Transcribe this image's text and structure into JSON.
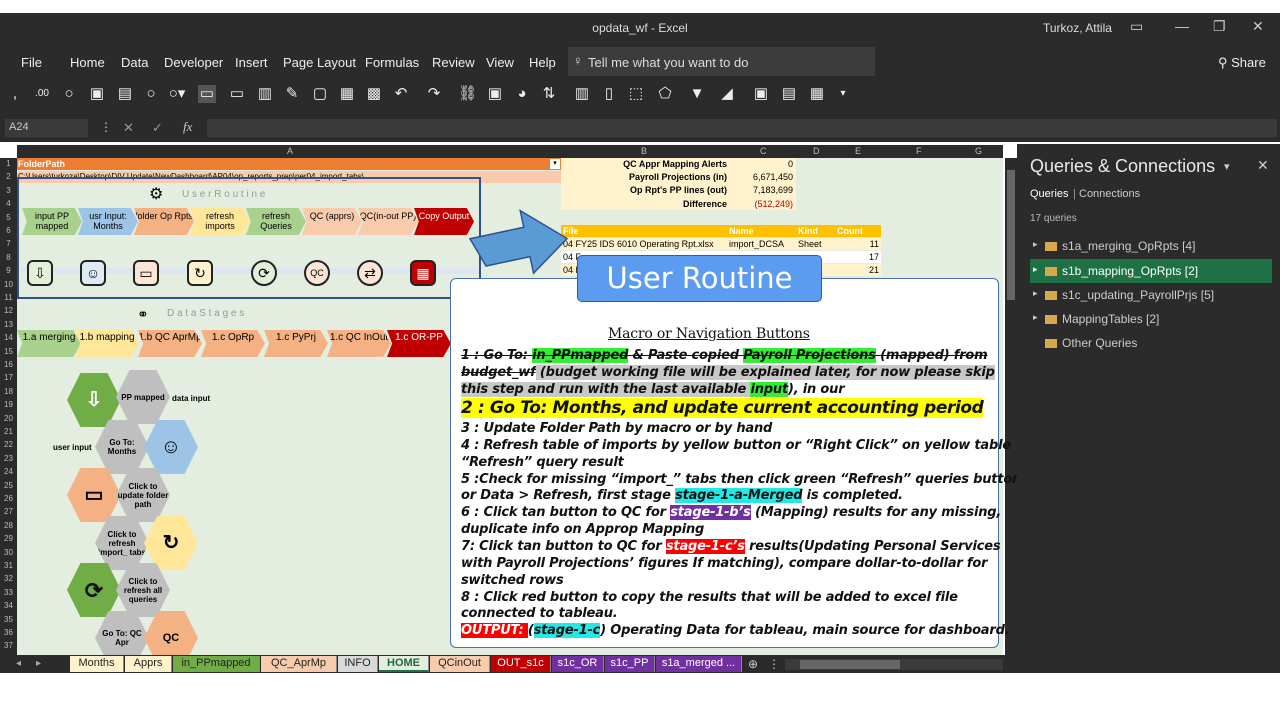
{
  "window": {
    "title": "opdata_wf  -  Excel",
    "user": "Turkoz, Attila"
  },
  "menu": [
    "File",
    "Home",
    "Data",
    "Developer",
    "Insert",
    "Page Layout",
    "Formulas",
    "Review",
    "View",
    "Help"
  ],
  "tell_me": "Tell me what you want to do",
  "share": "Share",
  "name_box": "A24",
  "columns": [
    "A",
    "B",
    "C",
    "D",
    "E",
    "F",
    "G"
  ],
  "rows": [
    "1",
    "2",
    "3",
    "4",
    "5",
    "6",
    "7",
    "8",
    "9",
    "10",
    "11",
    "12",
    "13",
    "14",
    "15",
    "16",
    "17",
    "18",
    "19",
    "20",
    "21",
    "22",
    "23",
    "24",
    "25",
    "26",
    "27",
    "28",
    "29",
    "30",
    "31",
    "32",
    "33",
    "34",
    "35",
    "36",
    "37"
  ],
  "sheet": {
    "folder_path_label": "FolderPath",
    "folder_path_value": "C:\\Users\\turkoza\\Desktop\\DIV Update\\NewDashboard\\AP04\\op_reports_prep\\per04_import_tabs\\",
    "user_routine_heading": "U s e r   R o u t i n e",
    "data_stages_heading": "D a t a   S t a g e s",
    "routine_steps": [
      "input PP mapped",
      "usr Input: Months",
      "folder Op Rpts",
      "refresh imports",
      "refresh Queries",
      "QC (apprs)",
      "QC(in-out PP)",
      "Copy Output"
    ],
    "stages": [
      "1.a merging",
      "1.b mapping",
      "1.b QC AprMp",
      "1.c OpRp",
      "1.c PyPrj",
      "1.c QC InOut",
      "1.c OR-PP"
    ],
    "hex_labels": {
      "pp_mapped": "PP mapped",
      "data_input": "data input",
      "user_input": "user input",
      "goto_months": "Go To: Months",
      "click_folder": "Click to update folder path",
      "click_refresh_imports": "Click to refresh import_ tabs",
      "click_refresh_queries": "Click to refresh all queries",
      "goto_qcapr": "Go To: QC Apr"
    },
    "qc": [
      {
        "label": "QC Appr Mapping Alerts",
        "value": "0"
      },
      {
        "label": "Payroll Projections (in)",
        "value": "6,671,450"
      },
      {
        "label": "Op Rpt's PP lines (out)",
        "value": "7,183,699"
      },
      {
        "label": "Difference",
        "value": "(512,249)"
      }
    ],
    "table_headers": [
      "File",
      "Name",
      "Kind",
      "Count"
    ],
    "table_rows": [
      {
        "file": "04 FY25 IDS 6010 Operating Rpt.xlsx",
        "name": "import_DCSA",
        "kind": "Sheet",
        "count": "11"
      },
      {
        "file": "04 F",
        "name": "",
        "kind": "",
        "count": "17"
      },
      {
        "file": "04 F",
        "name": "",
        "kind": "",
        "count": "21"
      }
    ]
  },
  "callout": {
    "banner": "User Routine",
    "title": "Macro or Navigation Buttons",
    "l1a": "1 : Go To: ",
    "l1b": "in_PPmapped",
    "l1c": " & Paste copied ",
    "l1d": "Payroll Projections",
    "l1e": " (mapped) from",
    "l2a": "budget_wf",
    "l2b": " (budget working file will be explained later, for now please skip",
    "l3a": "this step and run with the last available ",
    "l3b": "input",
    "l3c": "), in our",
    "l4": "2 : Go To:  Months,  and update current accounting period",
    "l5": "3 : Update Folder Path by macro or by hand",
    "l6": "4 : Refresh table of imports by yellow button or “Right Click” on yellow table",
    "l7": "“Refresh” query result",
    "l8": "5 :Check for missing “import_” tabs then click green “Refresh” queries button",
    "l9a": "or Data > Refresh, first stage ",
    "l9b": "stage-1-a-Merged",
    "l9c": " is completed.",
    "l10a": "6 : Click tan button to QC for ",
    "l10b": "stage-1-b’s",
    "l10c": " (Mapping) results for any missing,",
    "l11": "duplicate  info on Approp  Mapping",
    "l12a": "7: Click tan button to QC for ",
    "l12b": "stage-1-c’s",
    "l12c": " results(Updating Personal Services",
    "l13": "with Payroll  Projections’ figures If matching), compare dollar-to-dollar  for",
    "l14": "switched rows",
    "l15": "8 : Click red button to copy the results that will be added to excel file",
    "l16": "connected to tableau.",
    "l17a": "OUTPUT: ",
    "l17b": "(",
    "l17c": "stage-1-c",
    "l17d": ") Operating Data for tableau, main source for dashboard."
  },
  "tabs": [
    "Months",
    "Apprs",
    "in_PPmapped",
    "QC_AprMp",
    "INFO",
    "HOME",
    "QCinOut",
    "OUT_s1c",
    "s1c_OR",
    "s1c_PP",
    "s1a_merged ..."
  ],
  "pane": {
    "title": "Queries & Connections",
    "tab_queries": "Queries",
    "tab_connections": "Connections",
    "count": "17 queries",
    "groups": [
      "s1a_merging_OpRpts [4]",
      "s1b_mapping_OpRpts [2]",
      "s1c_updating_PayrollPrjs [5]",
      "MappingTables [2]",
      "Other Queries"
    ]
  },
  "colors": {
    "accent": "#217346",
    "selected_group": "#1e7145",
    "dark_bg": "#2b2b2b",
    "sheet_bg": "#e3eee0"
  }
}
